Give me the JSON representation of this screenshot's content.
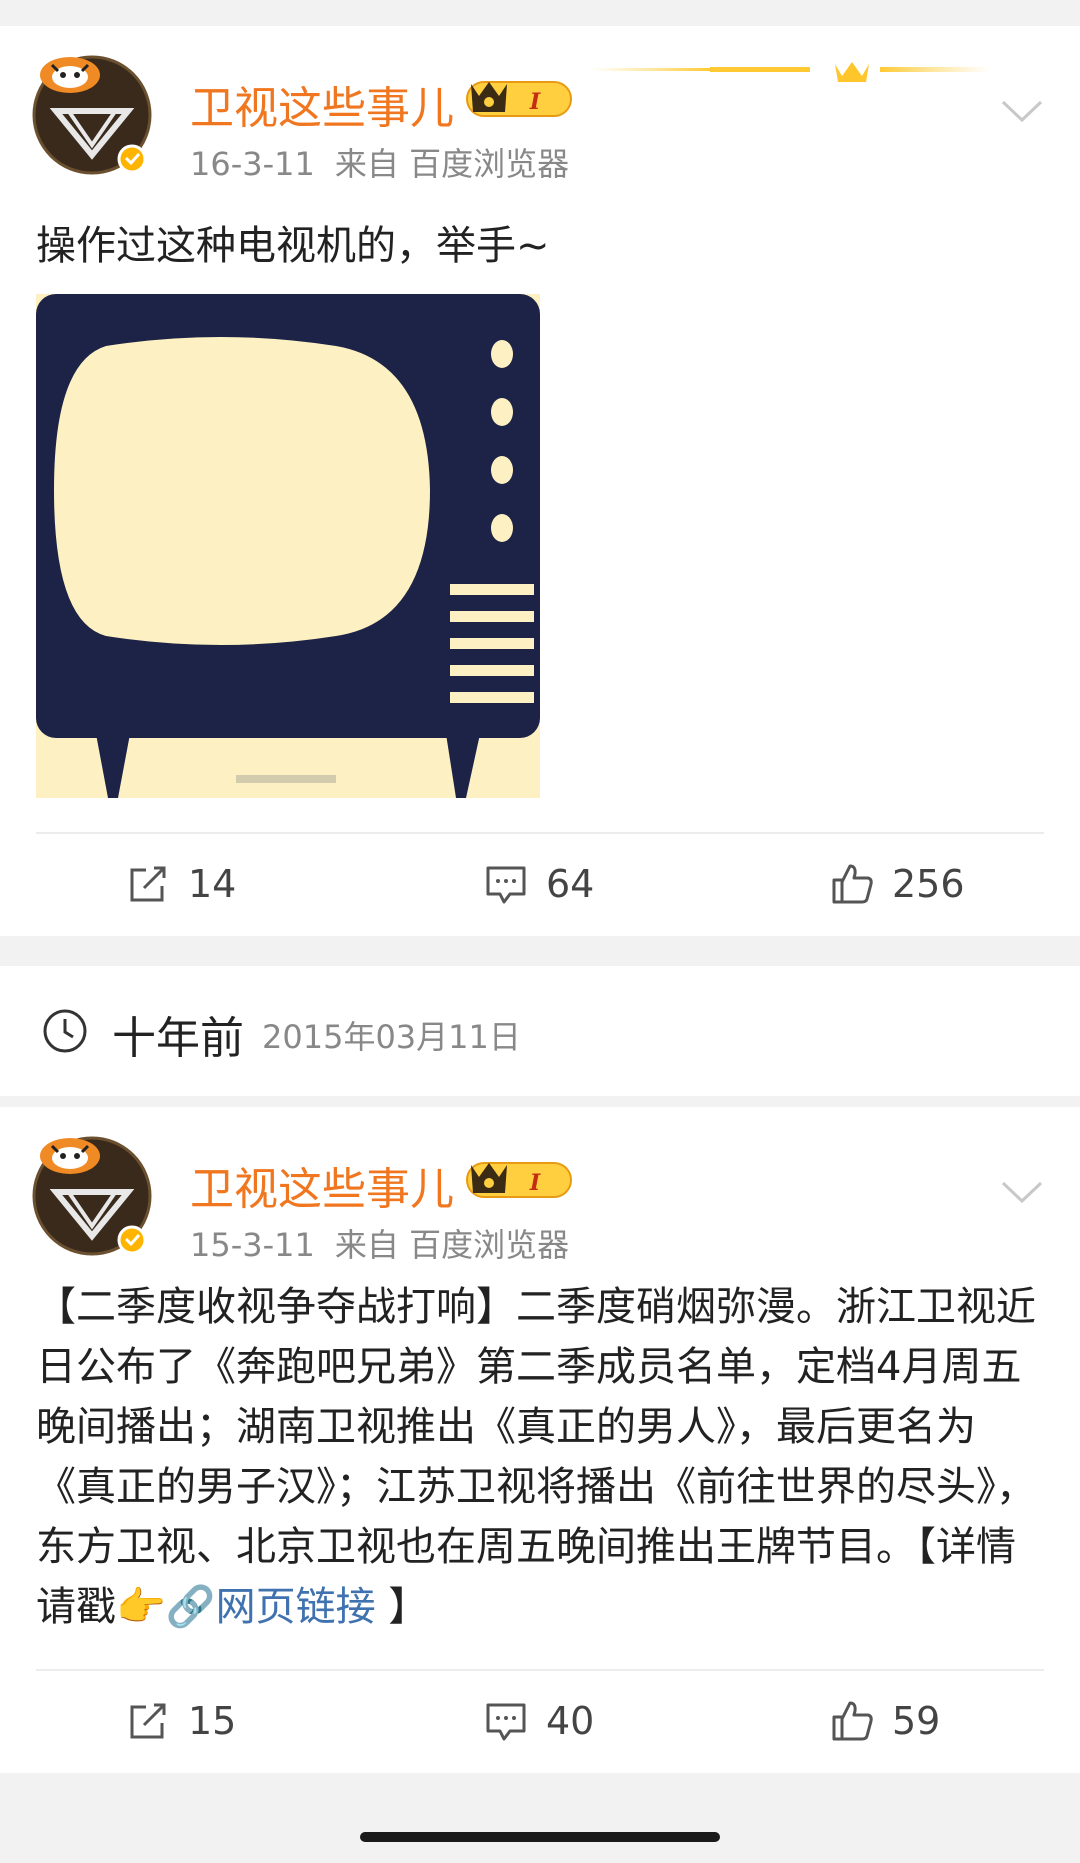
{
  "posts": [
    {
      "username": "卫视这些事儿",
      "vip_level": "I",
      "time": "16-3-11",
      "source": "来自 百度浏览器",
      "text": "操作过这种电视机的，举手~",
      "stats": {
        "reposts": "14",
        "comments": "64",
        "likes": "256"
      }
    },
    {
      "username": "卫视这些事儿",
      "vip_level": "I",
      "time": "15-3-11",
      "source": "来自 百度浏览器",
      "text": "【二季度收视争夺战打响】二季度硝烟弥漫。浙江卫视近日公布了《奔跑吧兄弟》第二季成员名单，定档4月周五晚间播出；湖南卫视推出《真正的男人》，最后更名为《真正的男子汉》；江苏卫视将播出《前往世界的尽头》，东方卫视、北京卫视也在周五晚间推出王牌节目。【详情请戳👉",
      "link_text": "网页链接",
      "text_end": " 】",
      "stats": {
        "reposts": "15",
        "comments": "40",
        "likes": "59"
      }
    }
  ],
  "section_header": {
    "relative": "十年前",
    "absolute": "2015年03月11日",
    "icon": "clock-icon"
  },
  "colors": {
    "username": "#f0771f",
    "link": "#3f72af",
    "tv_body": "#1c2347",
    "tv_screen": "#fdf0c2"
  }
}
